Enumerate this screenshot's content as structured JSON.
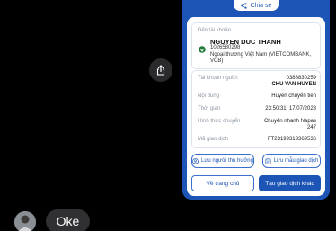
{
  "chat": {
    "message_text": "Oke",
    "share_icon": "share-up-icon"
  },
  "receipt": {
    "share_label": "Chia sẻ",
    "recipient": {
      "label": "Đến tài khoản",
      "name": "NGUYEN DUC THANH",
      "account_number": "1026580298",
      "bank": "Ngoại thương Việt Nam (VIETCOMBANK, VCB)"
    },
    "details": [
      {
        "label": "Tài khoản nguồn",
        "value": "0388830259",
        "value2": "CHU VAN HUYEN"
      },
      {
        "label": "Nội dung",
        "value": "Huyen chuyển tiền"
      },
      {
        "label": "Thời gian",
        "value": "23:50:31, 17/07/2023"
      },
      {
        "label": "Hình thức chuyển",
        "value": "Chuyển nhanh Napas",
        "value2": "247"
      },
      {
        "label": "Mã giao dịch",
        "value": "FT23199313369536"
      }
    ],
    "actions": {
      "save_recipient": "Lưu người thụ hưởng",
      "save_template": "Lưu mẫu giao dịch",
      "home": "Về trang chủ",
      "new_transaction": "Tạo giao dịch khác"
    }
  },
  "colors": {
    "brand_blue": "#1c55b5",
    "chat_bubble": "#303033"
  }
}
